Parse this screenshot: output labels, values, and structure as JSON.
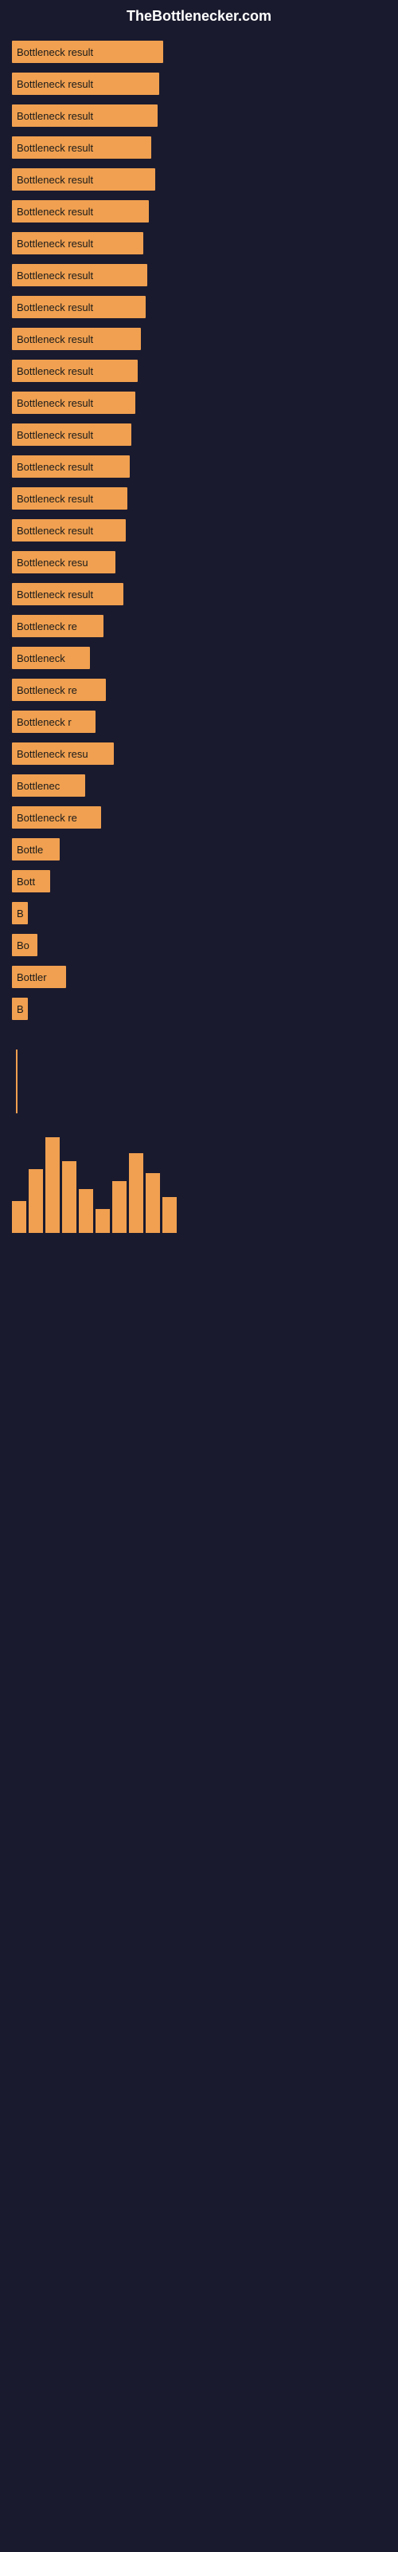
{
  "site": {
    "title": "TheBottlenecker.com"
  },
  "bars": [
    {
      "label": "Bottleneck result",
      "width": 190
    },
    {
      "label": "Bottleneck result",
      "width": 185
    },
    {
      "label": "Bottleneck result",
      "width": 183
    },
    {
      "label": "Bottleneck result",
      "width": 175
    },
    {
      "label": "Bottleneck result",
      "width": 180
    },
    {
      "label": "Bottleneck result",
      "width": 172
    },
    {
      "label": "Bottleneck result",
      "width": 165
    },
    {
      "label": "Bottleneck result",
      "width": 170
    },
    {
      "label": "Bottleneck result",
      "width": 168
    },
    {
      "label": "Bottleneck result",
      "width": 162
    },
    {
      "label": "Bottleneck result",
      "width": 158
    },
    {
      "label": "Bottleneck result",
      "width": 155
    },
    {
      "label": "Bottleneck result",
      "width": 150
    },
    {
      "label": "Bottleneck result",
      "width": 148
    },
    {
      "label": "Bottleneck result",
      "width": 145
    },
    {
      "label": "Bottleneck result",
      "width": 143
    },
    {
      "label": "Bottleneck resu",
      "width": 130
    },
    {
      "label": "Bottleneck result",
      "width": 140
    },
    {
      "label": "Bottleneck re",
      "width": 115
    },
    {
      "label": "Bottleneck",
      "width": 98
    },
    {
      "label": "Bottleneck re",
      "width": 118
    },
    {
      "label": "Bottleneck r",
      "width": 105
    },
    {
      "label": "Bottleneck resu",
      "width": 128
    },
    {
      "label": "Bottlenec",
      "width": 92
    },
    {
      "label": "Bottleneck re",
      "width": 112
    },
    {
      "label": "Bottle",
      "width": 60
    },
    {
      "label": "Bott",
      "width": 48
    },
    {
      "label": "B",
      "width": 20
    },
    {
      "label": "Bo",
      "width": 32
    },
    {
      "label": "Bottler",
      "width": 68
    },
    {
      "label": "B",
      "width": 18
    }
  ],
  "chart": {
    "vertical_line_visible": true,
    "bottom_bars": [
      4,
      8,
      14,
      10,
      6,
      3,
      7,
      12,
      9,
      5
    ]
  }
}
